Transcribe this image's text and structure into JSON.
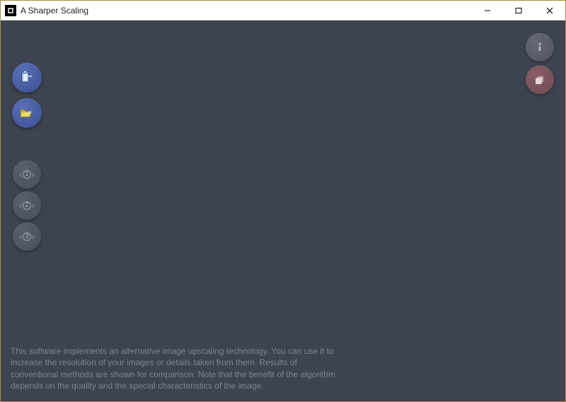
{
  "window": {
    "title": "A Sharper Scaling"
  },
  "buttons": {
    "paste": {
      "name": "paste-from-clipboard"
    },
    "open": {
      "name": "open-file"
    },
    "zoom1": {
      "label": "1"
    },
    "zoom2": {
      "label": "2"
    },
    "zoom3": {
      "label": "3"
    },
    "info": {
      "name": "info"
    },
    "batch": {
      "name": "batch"
    }
  },
  "description": "This software implements an alternative image upscaling technology. You can use it to increase the resolution of your images or details taken from them. Results of conventional methods are shown for comparison. Note that the benefit of the algorithm depends on the quality and the special characteristics of the image."
}
